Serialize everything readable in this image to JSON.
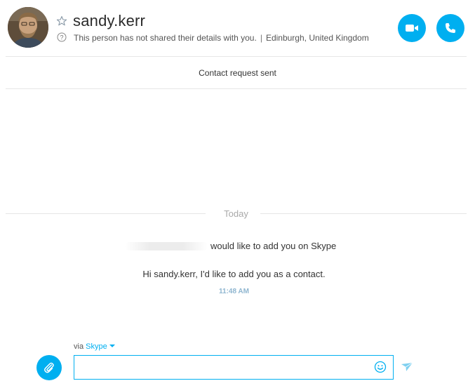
{
  "header": {
    "contact_name": "sandy.kerr",
    "privacy_note": "This person has not shared their details with you.",
    "separator": "|",
    "location": "Edinburgh, United Kingdom",
    "favorite_icon": "star-outline-icon",
    "info_icon": "question-circle-icon",
    "video_call_icon": "video-camera-icon",
    "audio_call_icon": "phone-icon"
  },
  "status": {
    "contact_request": "Contact request sent"
  },
  "conversation": {
    "date_label": "Today",
    "add_request_text": "would like to add you on Skype",
    "message_text": "Hi sandy.kerr, I'd like to add you as a contact.",
    "message_time": "11:48 AM"
  },
  "composer": {
    "via_prefix": "via",
    "via_service": "Skype",
    "input_value": "",
    "input_placeholder": "",
    "attach_icon": "paperclip-icon",
    "emoji_icon": "smiley-icon",
    "send_icon": "send-arrow-icon"
  },
  "colors": {
    "accent": "#00aff0",
    "timestamp": "#8fb6d0",
    "divider": "#e6e6e6",
    "muted_text": "#a9a9a9"
  }
}
